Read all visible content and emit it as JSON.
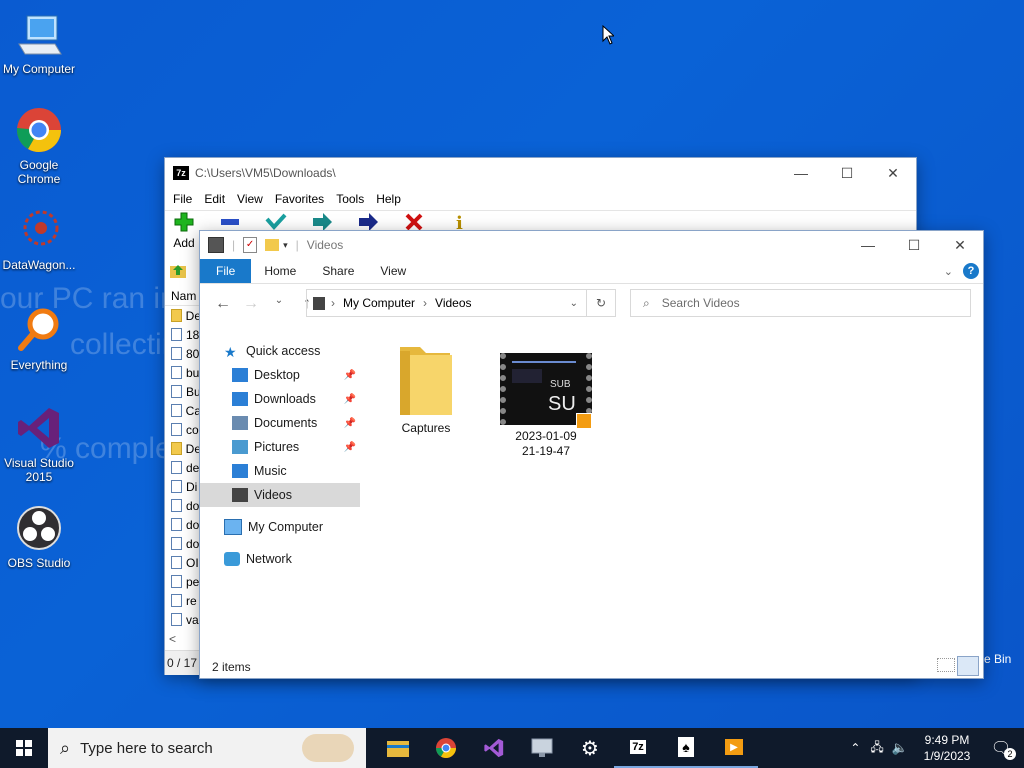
{
  "desktop": {
    "icons": [
      {
        "label": "My Computer"
      },
      {
        "label": "Google Chrome"
      },
      {
        "label": "DataWagon..."
      },
      {
        "label": "Everything"
      },
      {
        "label": "Visual Studio 2015"
      },
      {
        "label": "OBS Studio"
      }
    ],
    "wallpaper_text": [
      "our PC ran into",
      "collecting s",
      "% complete"
    ],
    "recycle_partial_label": "e Bin"
  },
  "sevenzip": {
    "title": "C:\\Users\\VM5\\Downloads\\",
    "menu": [
      "File",
      "Edit",
      "View",
      "Favorites",
      "Tools",
      "Help"
    ],
    "toolbar_add": "Add",
    "column_name": "Nam",
    "rows": [
      "De",
      "18",
      "80",
      "bu",
      "Bu",
      "Ca",
      "co",
      "De",
      "de",
      "Di",
      "do",
      "do",
      "do",
      "OI",
      "pe",
      "re",
      "va"
    ],
    "status": "0 / 17"
  },
  "explorer": {
    "title": "Videos",
    "ribbon_tabs": [
      "File",
      "Home",
      "Share",
      "View"
    ],
    "breadcrumb": [
      "My Computer",
      "Videos"
    ],
    "search_placeholder": "Search Videos",
    "nav": {
      "quick_access": "Quick access",
      "items": [
        {
          "label": "Desktop",
          "pinned": true
        },
        {
          "label": "Downloads",
          "pinned": true
        },
        {
          "label": "Documents",
          "pinned": true
        },
        {
          "label": "Pictures",
          "pinned": true
        },
        {
          "label": "Music",
          "pinned": false
        },
        {
          "label": "Videos",
          "pinned": false
        }
      ],
      "my_computer": "My Computer",
      "network": "Network"
    },
    "content": [
      {
        "label": "Captures",
        "type": "folder"
      },
      {
        "label": "2023-01-09 21-19-47",
        "type": "video",
        "thumb_text_1": "SUB",
        "thumb_text_2": "SU"
      }
    ],
    "status": "2 items"
  },
  "taskbar": {
    "search_placeholder": "Type here to search",
    "pinned": [
      "file-explorer-icon",
      "chrome-icon",
      "visual-studio-icon",
      "monitor-icon",
      "settings-icon",
      "7zip-icon",
      "solitaire-icon",
      "video-player-icon"
    ],
    "sevenzip_label": "7z",
    "time": "9:49 PM",
    "date": "1/9/2023",
    "notification_count": "2"
  },
  "colors": {
    "desktop": "#0a5bd1",
    "ribbon_file": "#1979ca",
    "taskbar": "#0f1a2b"
  }
}
